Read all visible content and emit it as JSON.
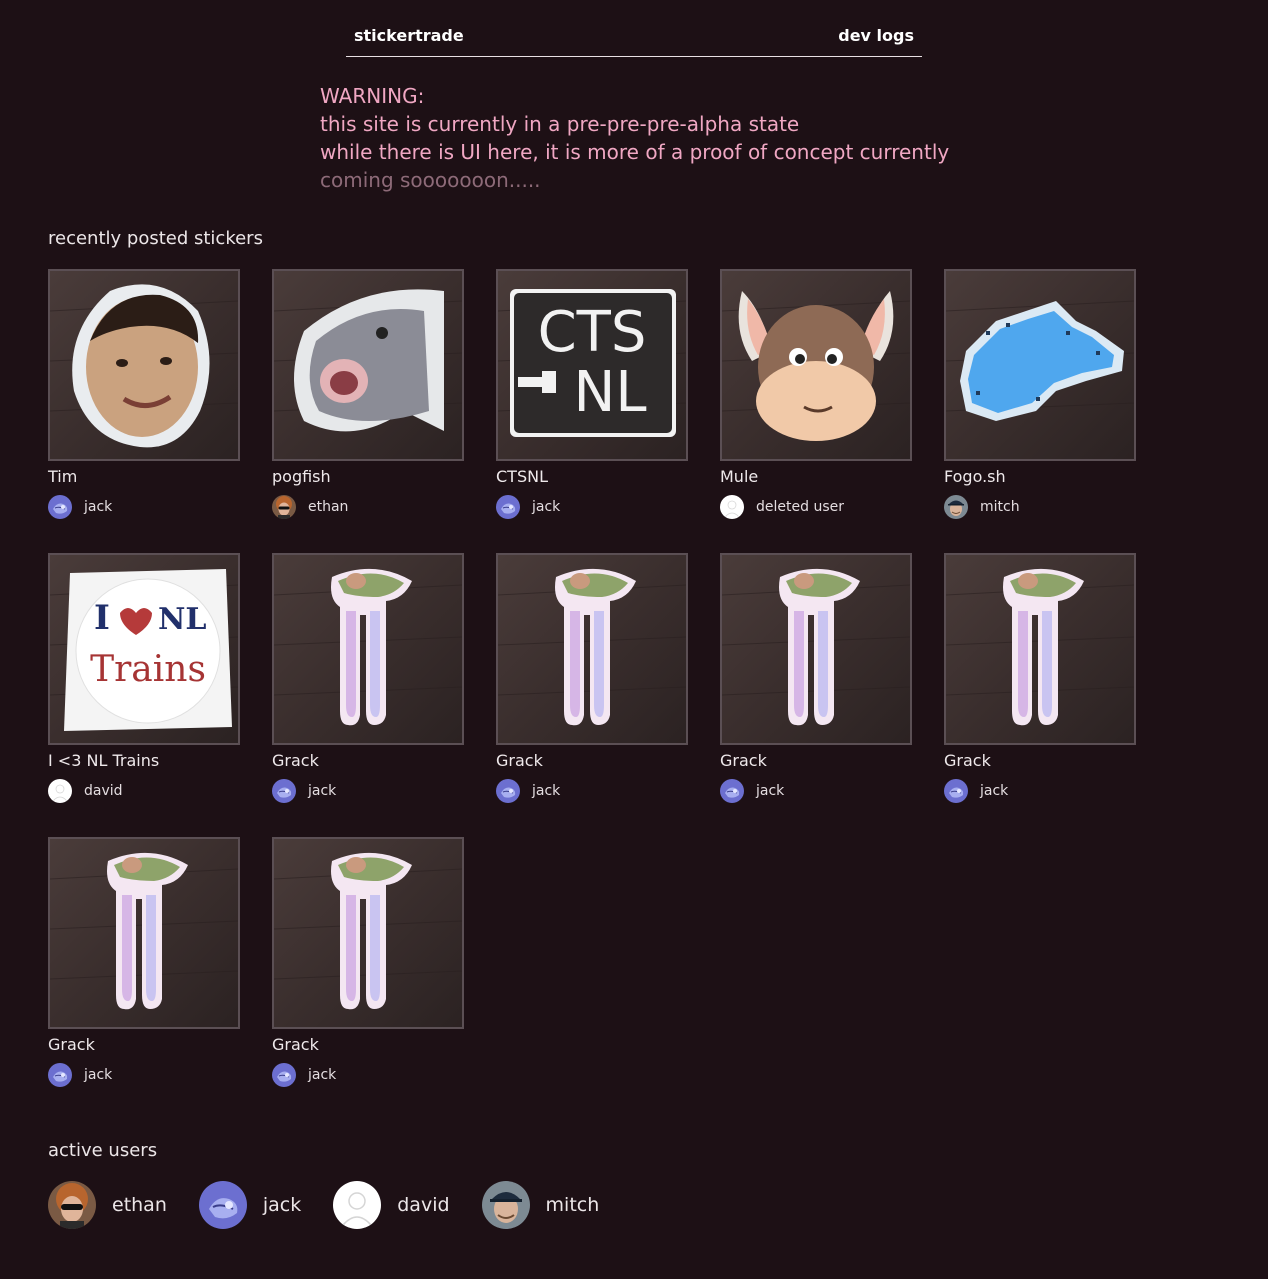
{
  "nav": {
    "brand": "stickertrade",
    "dev_logs": "dev logs"
  },
  "warning": {
    "line1": "WARNING:",
    "line2": "this site is currently in a pre-pre-pre-alpha state",
    "line3": "while there is UI here, it is more of a proof of concept currently",
    "line4": "coming sooooooon....."
  },
  "recent": {
    "title": "recently posted stickers",
    "stickers": [
      {
        "name": "Tim",
        "user": "jack",
        "image": "face-sticker"
      },
      {
        "name": "pogfish",
        "user": "ethan",
        "image": "fish-sticker"
      },
      {
        "name": "CTSNL",
        "user": "jack",
        "image": "ctsnl-sticker"
      },
      {
        "name": "Mule",
        "user": "deleted user",
        "image": "mule-sticker"
      },
      {
        "name": "Fogo.sh",
        "user": "mitch",
        "image": "map-sticker"
      },
      {
        "name": "I <3 NL Trains",
        "user": "david",
        "image": "trains-sticker"
      },
      {
        "name": "Grack",
        "user": "jack",
        "image": "grack-sticker"
      },
      {
        "name": "Grack",
        "user": "jack",
        "image": "grack-sticker"
      },
      {
        "name": "Grack",
        "user": "jack",
        "image": "grack-sticker"
      },
      {
        "name": "Grack",
        "user": "jack",
        "image": "grack-sticker"
      },
      {
        "name": "Grack",
        "user": "jack",
        "image": "grack-sticker"
      },
      {
        "name": "Grack",
        "user": "jack",
        "image": "grack-sticker"
      }
    ]
  },
  "active": {
    "title": "active users",
    "users": [
      "ethan",
      "jack",
      "david",
      "mitch"
    ]
  },
  "sticker_text": {
    "ctsnl_top": "CTS",
    "ctsnl_bottom": "NL",
    "trains_top": "I",
    "trains_nl": "NL",
    "trains_word": "Trains"
  }
}
